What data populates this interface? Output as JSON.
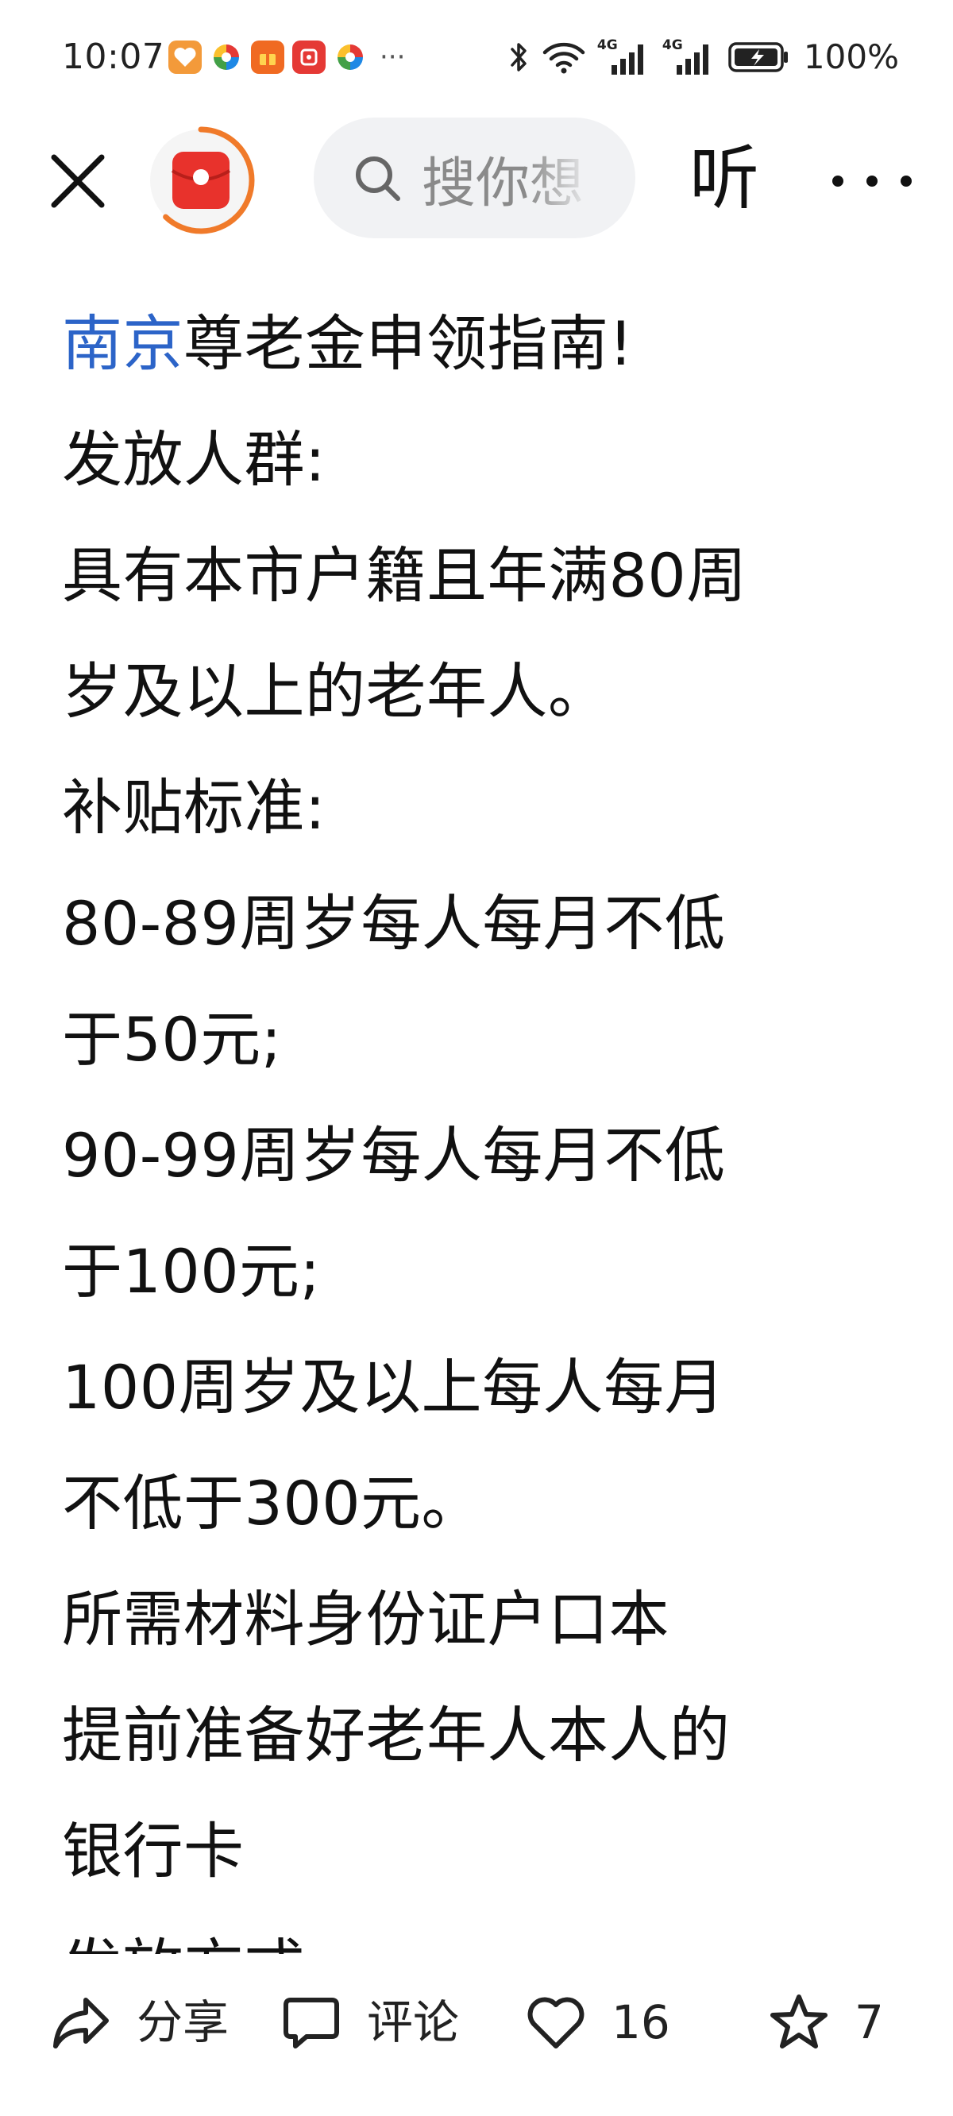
{
  "status_bar": {
    "time": "10:07",
    "notification_icons": [
      "heart-app-icon",
      "pinwheel-app-icon",
      "gift-app-icon",
      "red-app-icon",
      "pinwheel-app-icon"
    ],
    "overflow": "···",
    "network_1": "4G",
    "network_2": "4G",
    "battery": "100%"
  },
  "top_bar": {
    "search_placeholder": "搜你想",
    "listen_label": "听"
  },
  "article": {
    "title_link": "南京",
    "title_rest": "尊老金申领指南!",
    "lines": [
      "发放人群:",
      "具有本市户籍且年满80周",
      "岁及以上的老年人。",
      "补贴标准:",
      "80-89周岁每人每月不低",
      "于50元;",
      "90-99周岁每人每月不低",
      "于100元;",
      "100周岁及以上每人每月",
      "不低于300元。",
      "所需材料身份证户口本",
      "提前准备好老年人本人的",
      "银行卡",
      "发放方式:"
    ]
  },
  "actions": {
    "share_label": "分享",
    "comment_label": "评论",
    "like_count": "16",
    "favorite_count": "7"
  },
  "colors": {
    "link": "#2c64c8",
    "text": "#111111",
    "search_bg": "#f1f2f4",
    "avatar_ring": "#f07a2a",
    "avatar_red": "#e8322c"
  }
}
